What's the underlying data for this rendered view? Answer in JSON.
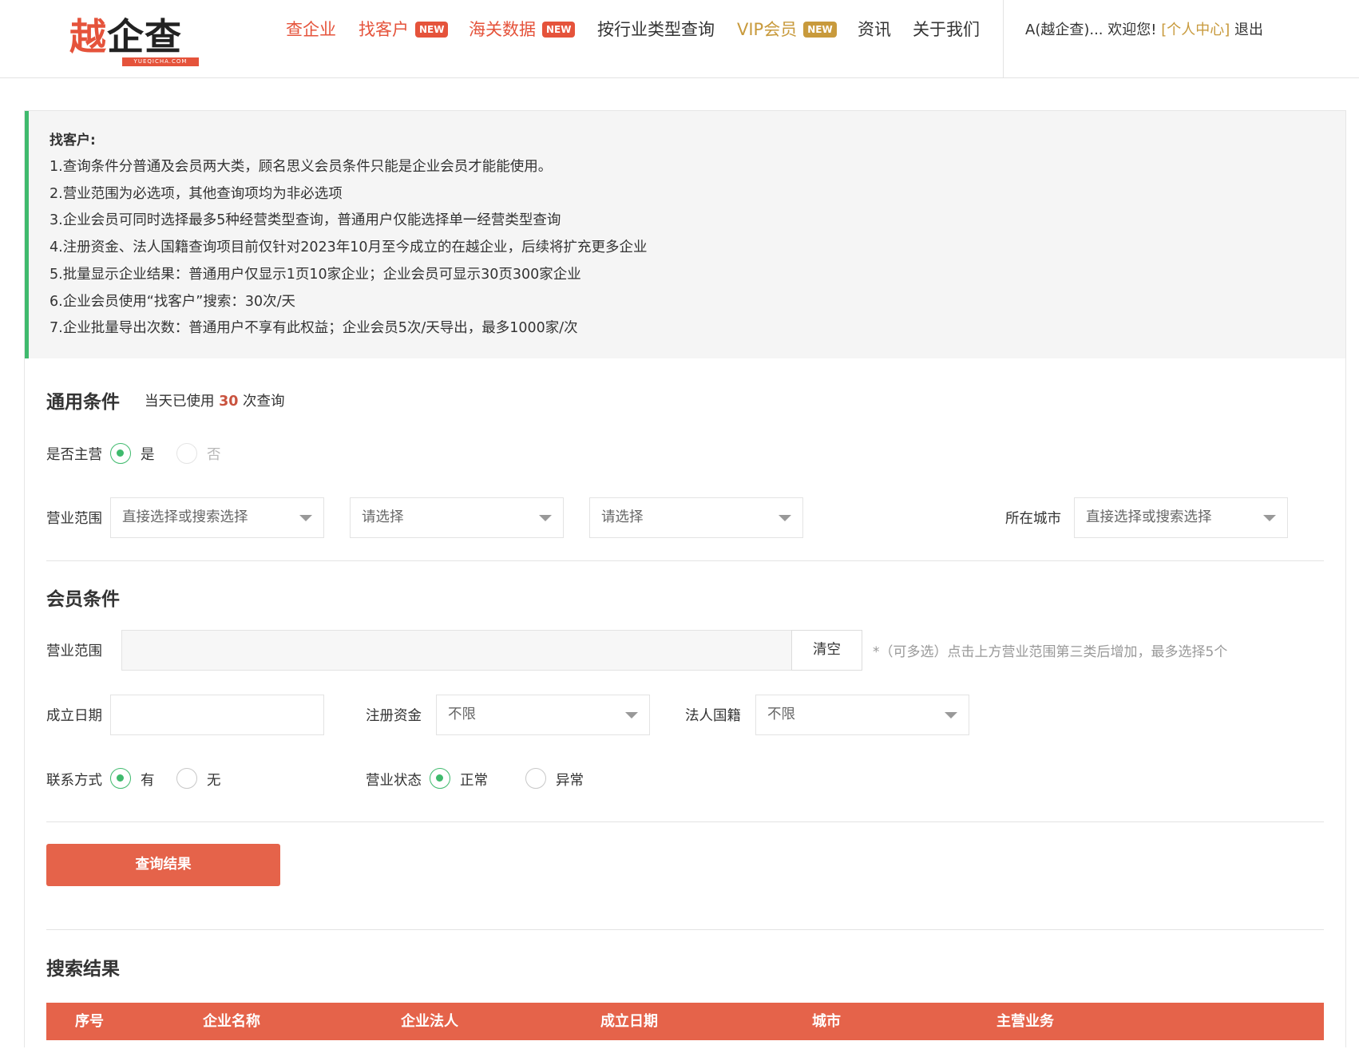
{
  "header": {
    "logo": {
      "main_1": "越",
      "main_2": "企查",
      "sub": "YUEQICHA.COM"
    },
    "nav": [
      {
        "label": "查企业"
      },
      {
        "label": "找客户",
        "badge": "NEW"
      },
      {
        "label": "海关数据",
        "badge": "NEW"
      },
      {
        "label": "按行业类型查询"
      },
      {
        "label": "VIP会员",
        "badge": "NEW"
      },
      {
        "label": "资讯"
      },
      {
        "label": "关于我们"
      }
    ],
    "user": {
      "greeting": "A(越企查)... 欢迎您!",
      "center": "[个人中心]",
      "logout": "退出"
    }
  },
  "notice": {
    "title": "找客户:",
    "lines": [
      "1.查询条件分普通及会员两大类，顾名思义会员条件只能是企业会员才能能使用。",
      "2.营业范围为必选项，其他查询项均为非必选项",
      "3.企业会员可同时选择最多5种经营类型查询，普通用户仅能选择单一经营类型查询",
      "4.注册资金、法人国籍查询项目前仅针对2023年10月至今成立的在越企业，后续将扩充更多企业",
      "5.批量显示企业结果：普通用户仅显示1页10家企业；企业会员可显示30页300家企业",
      "6.企业会员使用“找客户”搜索：30次/天",
      "7.企业批量导出次数：普通用户不享有此权益；企业会员5次/天导出，最多1000家/次"
    ]
  },
  "general": {
    "title": "通用条件",
    "usage_prefix": "当天已使用",
    "usage_count": "30",
    "usage_suffix": "次查询",
    "main_business": {
      "label": "是否主营",
      "yes": "是",
      "no": "否",
      "selected": "是"
    },
    "scope": {
      "label": "营业范围",
      "select1": "直接选择或搜索选择",
      "select2": "请选择",
      "select3": "请选择"
    },
    "city": {
      "label": "所在城市",
      "value": "直接选择或搜索选择"
    }
  },
  "member": {
    "title": "会员条件",
    "scope": {
      "label": "营业范围",
      "value": "",
      "clear": "清空",
      "hint": "*（可多选）点击上方营业范围第三类后增加，最多选择5个"
    },
    "founded": {
      "label": "成立日期",
      "value": ""
    },
    "capital": {
      "label": "注册资金",
      "value": "不限"
    },
    "nationality": {
      "label": "法人国籍",
      "value": "不限"
    },
    "contact": {
      "label": "联系方式",
      "yes": "有",
      "no": "无",
      "selected": "有"
    },
    "status": {
      "label": "营业状态",
      "normal": "正常",
      "abnormal": "异常",
      "selected": "正常"
    }
  },
  "query_button": "查询结果",
  "results": {
    "title": "搜索结果",
    "columns": [
      "序号",
      "企业名称",
      "企业法人",
      "成立日期",
      "城市",
      "主营业务"
    ]
  },
  "colors": {
    "brand_red": "#e5533b",
    "accent_green": "#3fba6d",
    "gold": "#c89a3c"
  }
}
